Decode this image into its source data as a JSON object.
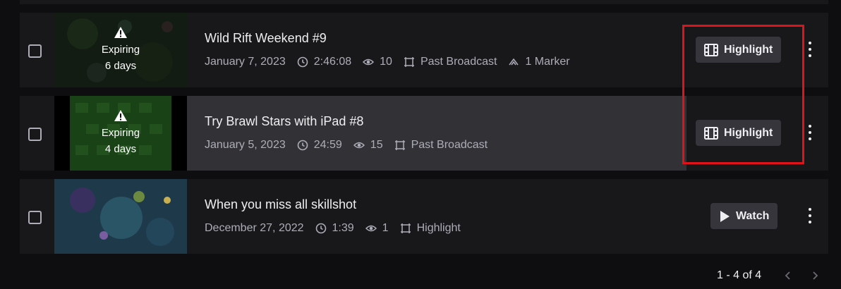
{
  "videos": [
    {
      "title": "Wild Rift Weekend #9",
      "date": "January 7, 2023",
      "duration": "2:46:08",
      "views": "10",
      "type": "Past Broadcast",
      "markers": "1 Marker",
      "expiring_label": "Expiring",
      "expiring_days": "6 days",
      "action_label": "Highlight",
      "action_icon": "film-icon"
    },
    {
      "title": "Try Brawl Stars with iPad #8",
      "date": "January 5, 2023",
      "duration": "24:59",
      "views": "15",
      "type": "Past Broadcast",
      "expiring_label": "Expiring",
      "expiring_days": "4 days",
      "action_label": "Highlight",
      "action_icon": "film-icon"
    },
    {
      "title": "When you miss all skillshot",
      "date": "December 27, 2022",
      "duration": "1:39",
      "views": "1",
      "type": "Highlight",
      "action_label": "Watch",
      "action_icon": "play-icon"
    }
  ],
  "pagination": {
    "range": "1 - 4 of 4"
  },
  "colors": {
    "annotation": "#e0131a",
    "row_bg": "#18181b",
    "hover_bg": "#323236",
    "button_bg": "#35353b"
  }
}
